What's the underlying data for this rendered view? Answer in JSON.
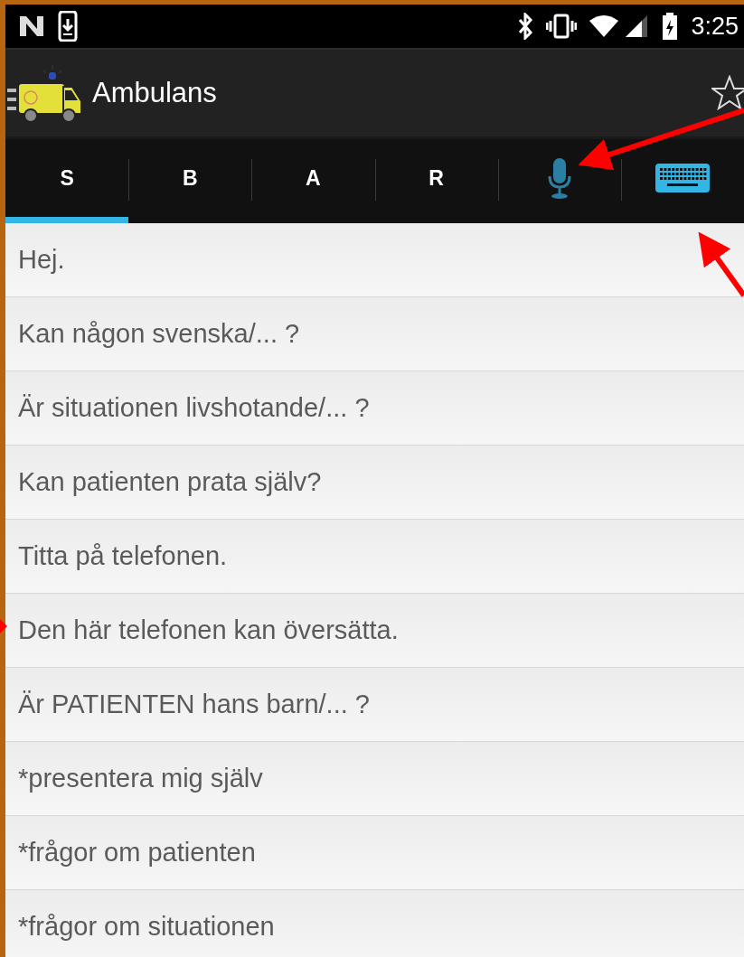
{
  "status_bar": {
    "time": "3:25"
  },
  "app_bar": {
    "title": "Ambulans",
    "starred": false
  },
  "tabs": [
    {
      "kind": "text",
      "label": "S",
      "selected": true
    },
    {
      "kind": "text",
      "label": "B",
      "selected": false
    },
    {
      "kind": "text",
      "label": "A",
      "selected": false
    },
    {
      "kind": "text",
      "label": "R",
      "selected": false
    },
    {
      "kind": "mic",
      "selected": false
    },
    {
      "kind": "keyboard",
      "selected": false
    }
  ],
  "phrases": [
    {
      "text": "Hej."
    },
    {
      "text": "Kan någon svenska/... ?"
    },
    {
      "text": "Är situationen livshotande/... ?"
    },
    {
      "text": "Kan patienten prata själv?"
    },
    {
      "text": "Titta på telefonen."
    },
    {
      "text": "Den här telefonen kan översätta."
    },
    {
      "text": "Är PATIENTEN hans barn/... ?"
    },
    {
      "text": "*presentera mig själv"
    },
    {
      "text": "*frågor om patienten"
    },
    {
      "text": "*frågor om situationen"
    }
  ]
}
